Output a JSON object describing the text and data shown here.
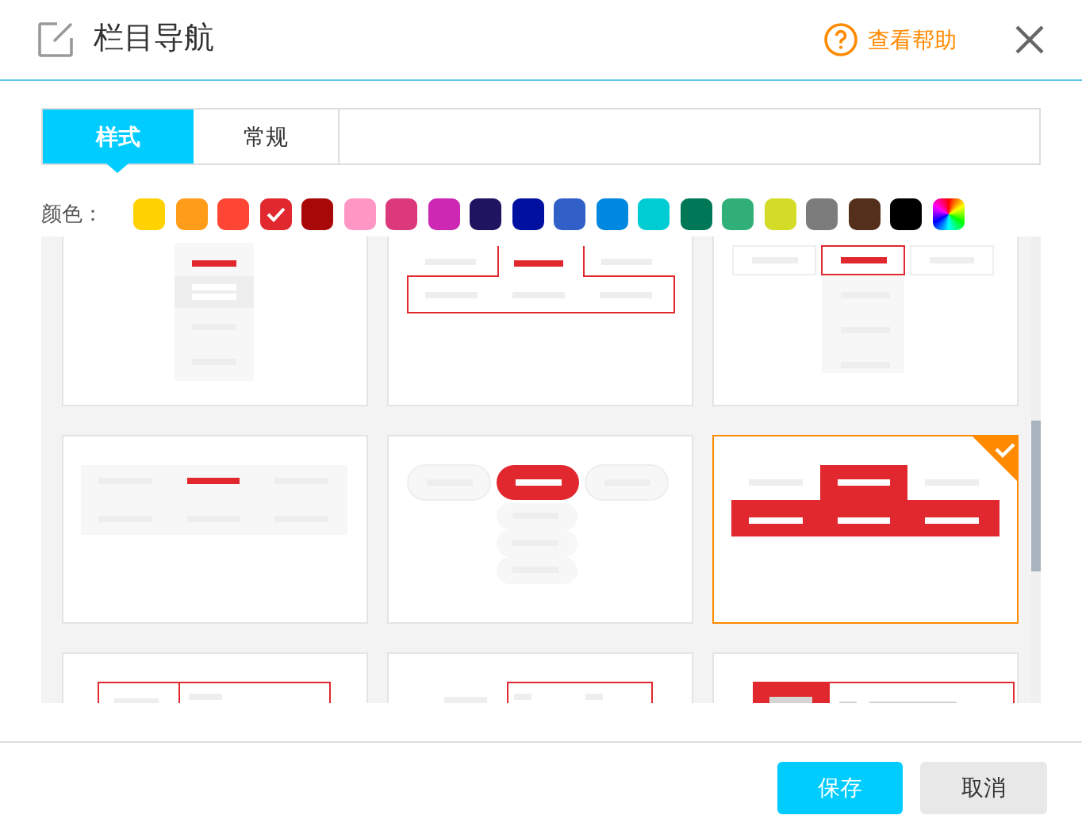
{
  "dialog": {
    "title": "栏目导航",
    "help_link": "查看帮助"
  },
  "tabs": [
    {
      "label": "样式",
      "selected": true
    },
    {
      "label": "常规",
      "selected": false
    }
  ],
  "color_label": "颜色：",
  "colors": [
    {
      "kind": "solid",
      "color": "#ffd200",
      "selected": false
    },
    {
      "kind": "solid",
      "color": "#ff9c1a",
      "selected": false
    },
    {
      "kind": "solid",
      "color": "#ff4533",
      "selected": false
    },
    {
      "kind": "solid",
      "color": "#e0282e",
      "selected": true
    },
    {
      "kind": "solid",
      "color": "#a80808",
      "selected": false
    },
    {
      "kind": "solid",
      "color": "#ff96c4",
      "selected": false
    },
    {
      "kind": "solid",
      "color": "#dc387c",
      "selected": false
    },
    {
      "kind": "solid",
      "color": "#cc28b4",
      "selected": false
    },
    {
      "kind": "solid",
      "color": "#1e1460",
      "selected": false
    },
    {
      "kind": "solid",
      "color": "#0010a0",
      "selected": false
    },
    {
      "kind": "solid",
      "color": "#305fc8",
      "selected": false
    },
    {
      "kind": "solid",
      "color": "#0088e0",
      "selected": false
    },
    {
      "kind": "solid",
      "color": "#00ccd4",
      "selected": false
    },
    {
      "kind": "solid",
      "color": "#007858",
      "selected": false
    },
    {
      "kind": "solid",
      "color": "#30b078",
      "selected": false
    },
    {
      "kind": "solid",
      "color": "#d4dc28",
      "selected": false
    },
    {
      "kind": "solid",
      "color": "#7c7c7c",
      "selected": false
    },
    {
      "kind": "solid",
      "color": "#54301c",
      "selected": false
    },
    {
      "kind": "solid",
      "color": "#000000",
      "selected": false
    },
    {
      "kind": "picker",
      "selected": false
    }
  ],
  "styles": [
    {
      "kind": "vertical",
      "selected": false
    },
    {
      "kind": "panel",
      "selected": false
    },
    {
      "kind": "boxed",
      "selected": false
    },
    {
      "kind": "flat",
      "selected": false
    },
    {
      "kind": "pill",
      "selected": false
    },
    {
      "kind": "block",
      "selected": true
    },
    {
      "kind": "split",
      "selected": false
    },
    {
      "kind": "offset",
      "selected": false
    },
    {
      "kind": "sidebar",
      "selected": false
    }
  ],
  "buttons": {
    "save": "保存",
    "cancel": "取消"
  }
}
